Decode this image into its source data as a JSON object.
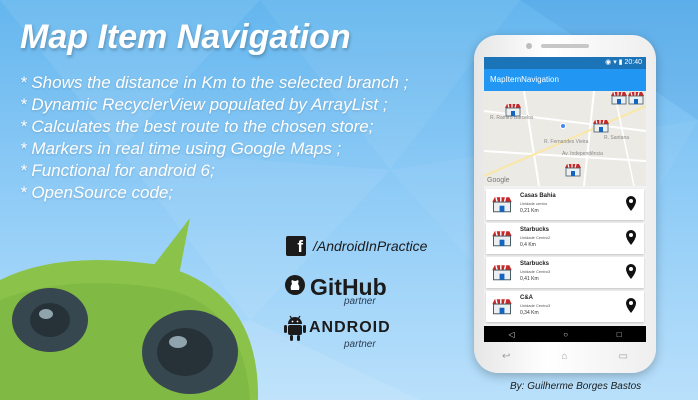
{
  "title": "Map Item Navigation",
  "features": [
    "* Shows the distance in Km to the selected branch ;",
    "* Dynamic RecyclerView populated by ArrayList ;",
    "* Calculates the best route to the chosen store;",
    "* Markers in real time using Google Maps ;",
    "* Functional for android 6;",
    "* OpenSource code;"
  ],
  "social": {
    "facebook_glyph": "f",
    "facebook_text": "/AndroidInPractice",
    "github_text": "GitHub",
    "github_partner": "partner",
    "android_text": "ANDROID",
    "android_partner": "partner"
  },
  "byline": "By:  Guilherme Borges Bastos",
  "phone": {
    "status_time": "20:40",
    "app_title": "MapItemNavigation",
    "map_attribution": "Google",
    "map_labels": [
      "R. Ramiro Barcelos",
      "R. Fernandes Vieira",
      "Av. Independência",
      "R. Santana"
    ],
    "stores": [
      {
        "name": "Casas Bahia",
        "unit": "Unidade centro",
        "distance": "0,21 Km"
      },
      {
        "name": "Starbucks",
        "unit": "Unidade Centro2",
        "distance": "0,4 Km"
      },
      {
        "name": "Starbucks",
        "unit": "Unidade Centro3",
        "distance": "0,41 Km"
      },
      {
        "name": "C&A",
        "unit": "Unidade Centro3",
        "distance": "0,34 Km"
      }
    ],
    "nav": {
      "back": "◁",
      "home": "○",
      "recent": "□"
    },
    "hw_nav": {
      "back": "↩",
      "home": "⌂",
      "recent": "▭"
    }
  },
  "colors": {
    "background": "#7cc1f2",
    "appbar": "#2196f3",
    "statusbar": "#1c74b8",
    "robot_green": "#8bc34a"
  }
}
